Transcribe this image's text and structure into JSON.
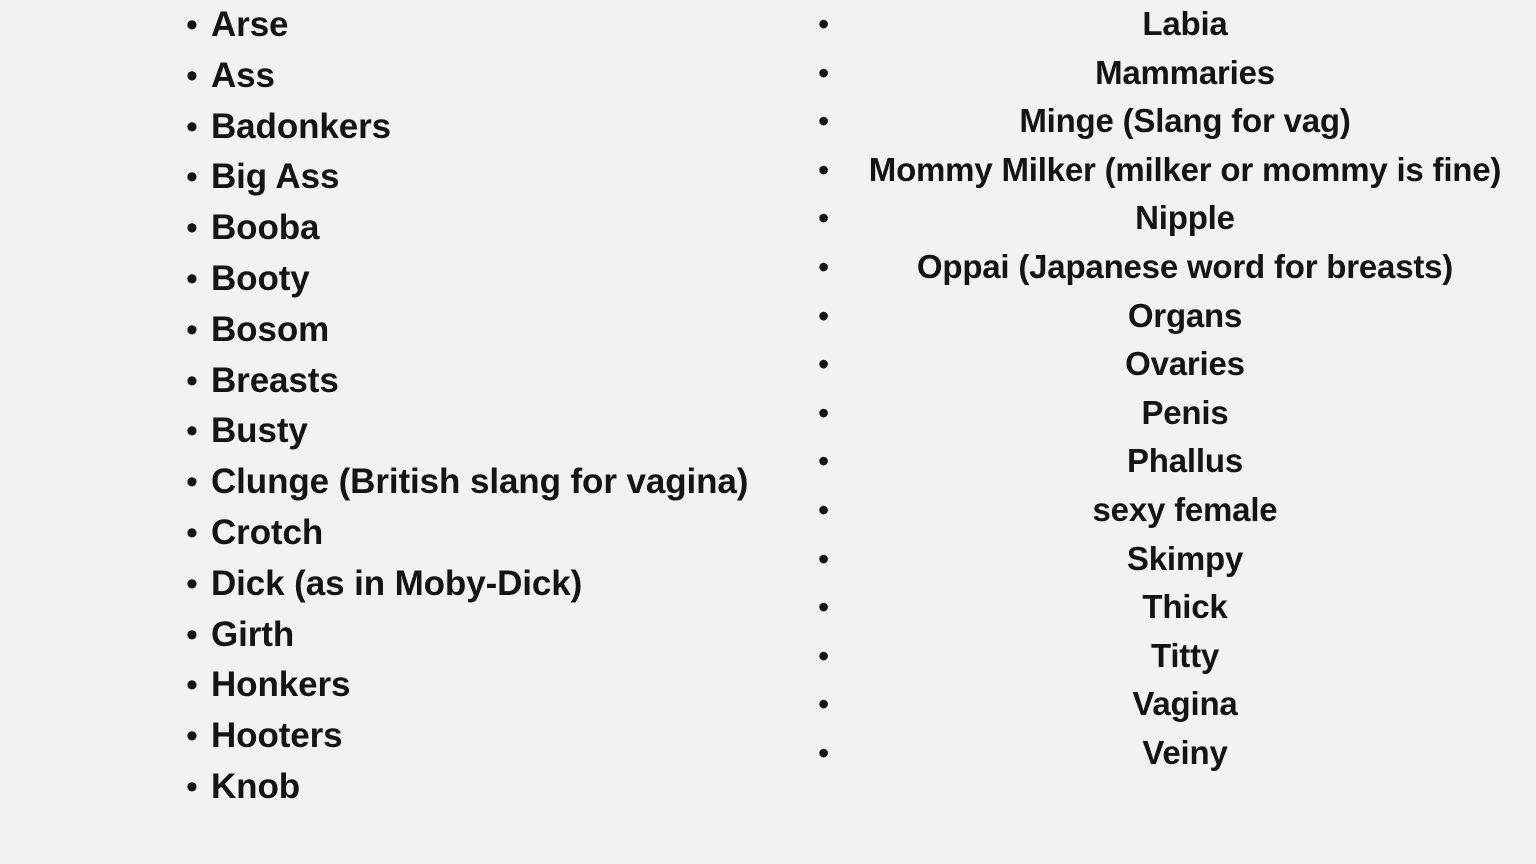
{
  "page": {
    "background_color": "#f2f2f2",
    "text_color": "#141414",
    "bullet_glyph": "•"
  },
  "columns": [
    {
      "name": "left-column",
      "align": "left",
      "items": [
        {
          "label": "Arse"
        },
        {
          "label": "Ass"
        },
        {
          "label": "Badonkers"
        },
        {
          "label": "Big Ass"
        },
        {
          "label": "Booba"
        },
        {
          "label": "Booty"
        },
        {
          "label": "Bosom"
        },
        {
          "label": "Breasts"
        },
        {
          "label": "Busty"
        },
        {
          "label": "Clunge (British slang for vagina)"
        },
        {
          "label": "Crotch"
        },
        {
          "label": "Dick (as in Moby-Dick)"
        },
        {
          "label": "Girth"
        },
        {
          "label": "Honkers"
        },
        {
          "label": "Hooters"
        },
        {
          "label": "Knob"
        }
      ]
    },
    {
      "name": "right-column",
      "align": "center",
      "items": [
        {
          "label": "Labia"
        },
        {
          "label": "Mammaries"
        },
        {
          "label": "Minge (Slang for vag)"
        },
        {
          "label": "Mommy Milker (milker or mommy is fine)"
        },
        {
          "label": "Nipple"
        },
        {
          "label": "Oppai (Japanese word for breasts)"
        },
        {
          "label": "Organs"
        },
        {
          "label": "Ovaries"
        },
        {
          "label": "Penis"
        },
        {
          "label": "Phallus"
        },
        {
          "label": "sexy female"
        },
        {
          "label": "Skimpy"
        },
        {
          "label": "Thick"
        },
        {
          "label": "Titty"
        },
        {
          "label": "Vagina"
        },
        {
          "label": "Veiny"
        }
      ]
    }
  ]
}
